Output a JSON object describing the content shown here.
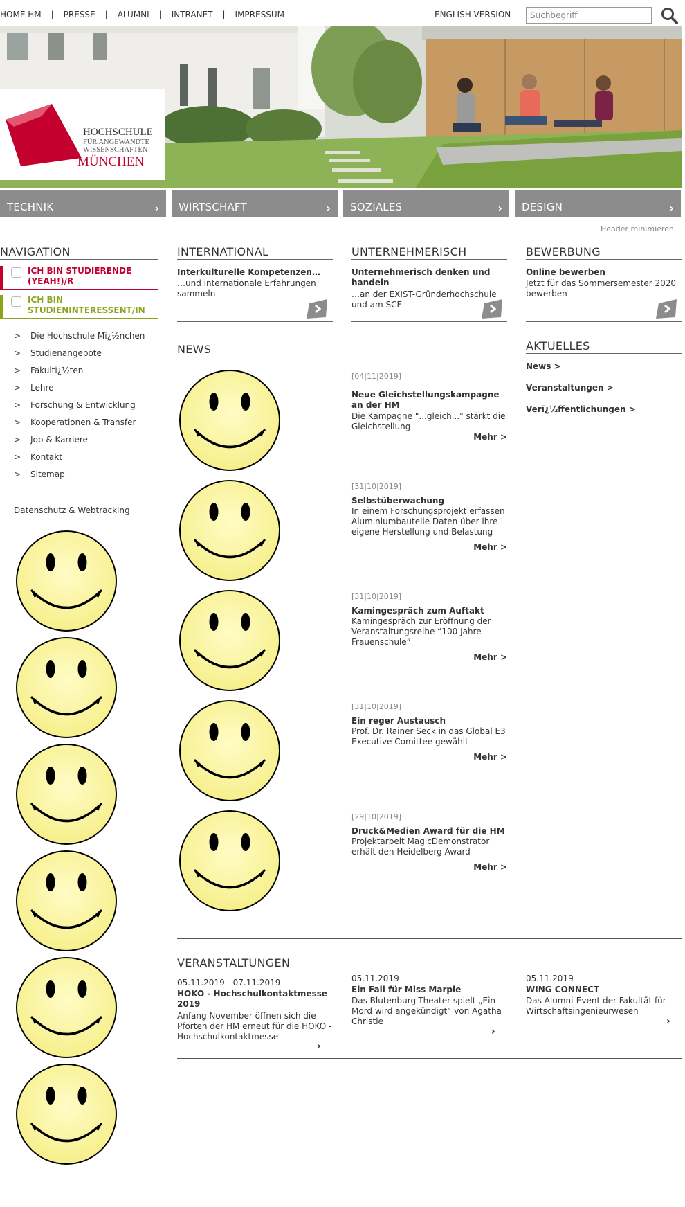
{
  "topnav": {
    "items": [
      "HOME HM",
      "PRESSE",
      "ALUMNI",
      "INTRANET",
      "IMPRESSUM"
    ],
    "english": "ENGLISH VERSION",
    "search_placeholder": "Suchbegriff"
  },
  "logo": {
    "line1": "HOCHSCHULE",
    "line2": "FÜR ANGEWANDTE",
    "line3": "WISSENSCHAFTEN",
    "line4": "MÜNCHEN"
  },
  "faculties": [
    "TECHNIK",
    "WIRTSCHAFT",
    "SOZIALES",
    "DESIGN"
  ],
  "header_minimize": "Header minimieren",
  "navigation": {
    "title": "NAVIGATION",
    "role1": "ICH BIN STUDIERENDE (YEAH!)/R",
    "role2": "ICH BIN STUDIENINTERESSENT/IN",
    "items": [
      "Die Hochschule Mï¿½nchen",
      "Studienangebote",
      "Fakultï¿½ten",
      "Lehre",
      "Forschung & Entwicklung",
      "Kooperationen & Transfer",
      "Job & Karriere",
      "Kontakt",
      "Sitemap"
    ],
    "arrow": ">",
    "datenschutz": "Datenschutz & Webtracking"
  },
  "international": {
    "title": "INTERNATIONAL",
    "teaser_title": "Interkulturelle Kompetenzen…",
    "teaser_text": "…und internationale Erfahrungen sammeln"
  },
  "unternehmerisch": {
    "title": "UNTERNEHMERISCH",
    "teaser_title": "Unternehmerisch denken und handeln",
    "teaser_text": "…an der EXIST-Gründerhochschule und am SCE"
  },
  "bewerbung": {
    "title": "BEWERBUNG",
    "teaser_title": "Online bewerben",
    "teaser_text": "Jetzt für das Sommersemester 2020 bewerben"
  },
  "aktuelles": {
    "title": "AKTUELLES",
    "links": [
      "News >",
      "Veranstaltungen >",
      "Verï¿½ffentlichungen >"
    ]
  },
  "news": {
    "title": "NEWS",
    "more_label": "Mehr >",
    "items": [
      {
        "date": "[04|11|2019]",
        "title": "Neue Gleichstellungskampagne an der HM",
        "text": "Die Kampagne \"...gleich...\" stärkt die Gleichstellung"
      },
      {
        "date": "[31|10|2019]",
        "title": "Selbstüberwachung",
        "text": "In einem Forschungsprojekt erfassen Aluminiumbauteile Daten über ihre eigene Herstellung und Belastung"
      },
      {
        "date": "[31|10|2019]",
        "title": "Kamingespräch zum Auftakt",
        "text": "Kamingespräch zur Eröffnung der Veranstaltungsreihe “100 Jahre Frauenschule“"
      },
      {
        "date": "[31|10|2019]",
        "title": "Ein reger Austausch",
        "text": "Prof. Dr. Rainer Seck in das Global E3 Executive Comittee gewählt"
      },
      {
        "date": "[29|10|2019]",
        "title": "Druck&Medien Award für die HM",
        "text": "Projektarbeit MagicDemonstrator erhält den Heidelberg Award"
      }
    ]
  },
  "veranstaltungen": {
    "title": "VERANSTALTUNGEN",
    "items": [
      {
        "date": "05.11.2019 - 07.11.2019",
        "title": "HOKO - Hochschulkontaktmesse 2019",
        "text": "Anfang November öffnen sich die Pforten der HM erneut für die HOKO - Hochschulkontaktmesse"
      },
      {
        "date": "05.11.2019",
        "title": "Ein Fall für Miss Marple",
        "text": "Das Blutenburg-Theater spielt „Ein Mord wird angekündigt“ von Agatha Christie"
      },
      {
        "date": "05.11.2019",
        "title": "WING CONNECT",
        "text": "Das Alumni-Event der Fakultät für Wirtschaftsingenieurwesen"
      }
    ]
  },
  "colors": {
    "faculty_bg": "#8c8c8c",
    "role1": "#c4002f",
    "role2": "#8aa51b"
  },
  "icons": [
    "search-icon",
    "chevron-right-icon",
    "smiley-icon",
    "arrow-button-icon"
  ]
}
